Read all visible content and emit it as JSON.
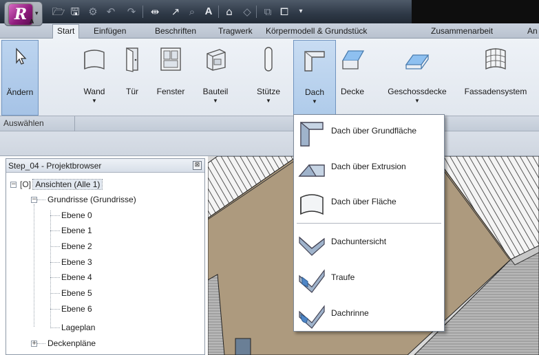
{
  "app": {
    "logo_letter": "R",
    "logo_sub": "A"
  },
  "tabs": [
    "Start",
    "Einfügen",
    "Beschriften",
    "Tragwerk",
    "Körpermodell & Grundstück",
    "Zusammenarbeit",
    "An"
  ],
  "ribbon": {
    "buttons": {
      "aendern": "Ändern",
      "wand": "Wand",
      "tuer": "Tür",
      "fenster": "Fenster",
      "bauteil": "Bauteil",
      "stuetze": "Stütze",
      "dach": "Dach",
      "decke": "Decke",
      "geschossdecke": "Geschossdecke",
      "fassadensystem": "Fassadensystem"
    },
    "panel_label": "Auswählen"
  },
  "browser": {
    "title": "Step_04 - Projektbrowser",
    "close": "⊠",
    "root": "Ansichten (Alle 1)",
    "grundrisse": "Grundrisse (Grundrisse)",
    "levels": [
      "Ebene 0",
      "Ebene 1",
      "Ebene 2",
      "Ebene 3",
      "Ebene 4",
      "Ebene 5",
      "Ebene 6",
      "Lageplan"
    ],
    "deckenplaene": "Deckenpläne"
  },
  "dach_menu": {
    "items": [
      "Dach über Grundfläche",
      "Dach über Extrusion",
      "Dach über Fläche",
      "Dachuntersicht",
      "Traufe",
      "Dachrinne"
    ]
  },
  "colors": {
    "ribbon_highlight": "#afcbea",
    "title_bar": "#2e3846",
    "logo": "#8f1b7d"
  }
}
